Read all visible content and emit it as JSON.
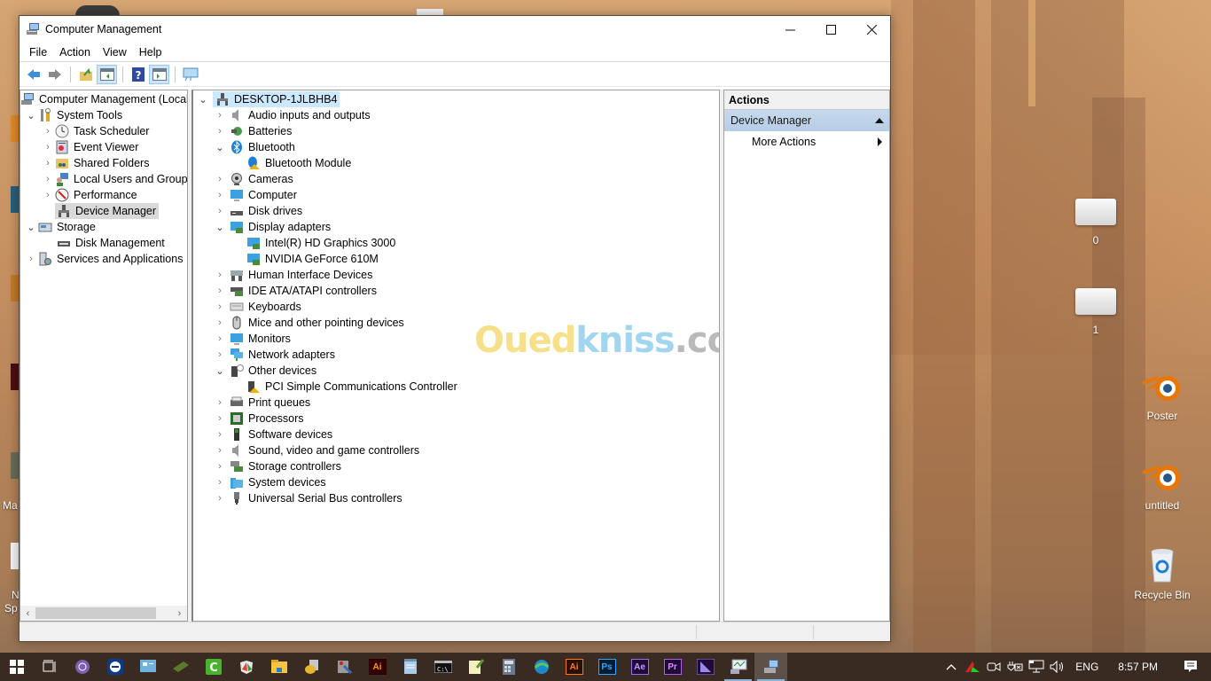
{
  "window": {
    "title": "Computer Management",
    "controls": {
      "minimize": "—",
      "maximize": "☐",
      "close": "✕"
    }
  },
  "menu": [
    "File",
    "Action",
    "View",
    "Help"
  ],
  "toolbar": {
    "buttons": [
      "back-icon",
      "forward-icon",
      "up-folder-icon",
      "show-hide-console-tree-icon",
      "help-icon",
      "show-hide-action-pane-icon",
      "monitor-icon"
    ]
  },
  "left_tree": {
    "root": "Computer Management (Local",
    "items": [
      {
        "label": "System Tools",
        "level": 1,
        "expanded": true
      },
      {
        "label": "Task Scheduler",
        "level": 2
      },
      {
        "label": "Event Viewer",
        "level": 2
      },
      {
        "label": "Shared Folders",
        "level": 2
      },
      {
        "label": "Local Users and Groups",
        "level": 2
      },
      {
        "label": "Performance",
        "level": 2
      },
      {
        "label": "Device Manager",
        "level": 2,
        "selected": true
      },
      {
        "label": "Storage",
        "level": 1,
        "expanded": true
      },
      {
        "label": "Disk Management",
        "level": 2
      },
      {
        "label": "Services and Applications",
        "level": 1
      }
    ]
  },
  "device_tree": {
    "computer": "DESKTOP-1JLBHB4",
    "categories": [
      {
        "label": "Audio inputs and outputs"
      },
      {
        "label": "Batteries"
      },
      {
        "label": "Bluetooth",
        "expanded": true,
        "children": [
          "Bluetooth Module"
        ]
      },
      {
        "label": "Cameras"
      },
      {
        "label": "Computer"
      },
      {
        "label": "Disk drives"
      },
      {
        "label": "Display adapters",
        "expanded": true,
        "children": [
          "Intel(R) HD Graphics 3000",
          "NVIDIA GeForce 610M"
        ]
      },
      {
        "label": "Human Interface Devices"
      },
      {
        "label": "IDE ATA/ATAPI controllers"
      },
      {
        "label": "Keyboards"
      },
      {
        "label": "Mice and other pointing devices"
      },
      {
        "label": "Monitors"
      },
      {
        "label": "Network adapters"
      },
      {
        "label": "Other devices",
        "expanded": true,
        "children": [
          "PCI Simple Communications Controller"
        ]
      },
      {
        "label": "Print queues"
      },
      {
        "label": "Processors"
      },
      {
        "label": "Software devices"
      },
      {
        "label": "Sound, video and game controllers"
      },
      {
        "label": "Storage controllers"
      },
      {
        "label": "System devices"
      },
      {
        "label": "Universal Serial Bus controllers"
      }
    ]
  },
  "actions": {
    "header": "Actions",
    "section": "Device Manager",
    "items": [
      "More Actions"
    ]
  },
  "watermark": {
    "part1": "Oued",
    "part2": "kniss",
    "part3": ".com"
  },
  "desktop": {
    "icons": [
      "0",
      "1",
      "Poster",
      "untitled",
      "Recycle Bin"
    ],
    "left_edge_labels": [
      "Ma",
      "N",
      "Sp"
    ]
  },
  "taskbar": {
    "apps": [
      "Start",
      "Task View",
      "Tor Browser",
      "TeamViewer",
      "Control Panel",
      "Graphics Card",
      "Camtasia",
      "Malwarebytes",
      "File Explorer",
      "Cheat Engine",
      "Paint Tool",
      "Illustrator",
      "Notepad",
      "Command Prompt",
      "Notepad++",
      "Calculator",
      "Edge",
      "Illustrator",
      "Photoshop",
      "After Effects",
      "Premiere Pro",
      "Media Encoder",
      "Performance Monitor",
      "Computer Management"
    ],
    "tray": {
      "language": "ENG",
      "time": "8:57 PM"
    }
  }
}
